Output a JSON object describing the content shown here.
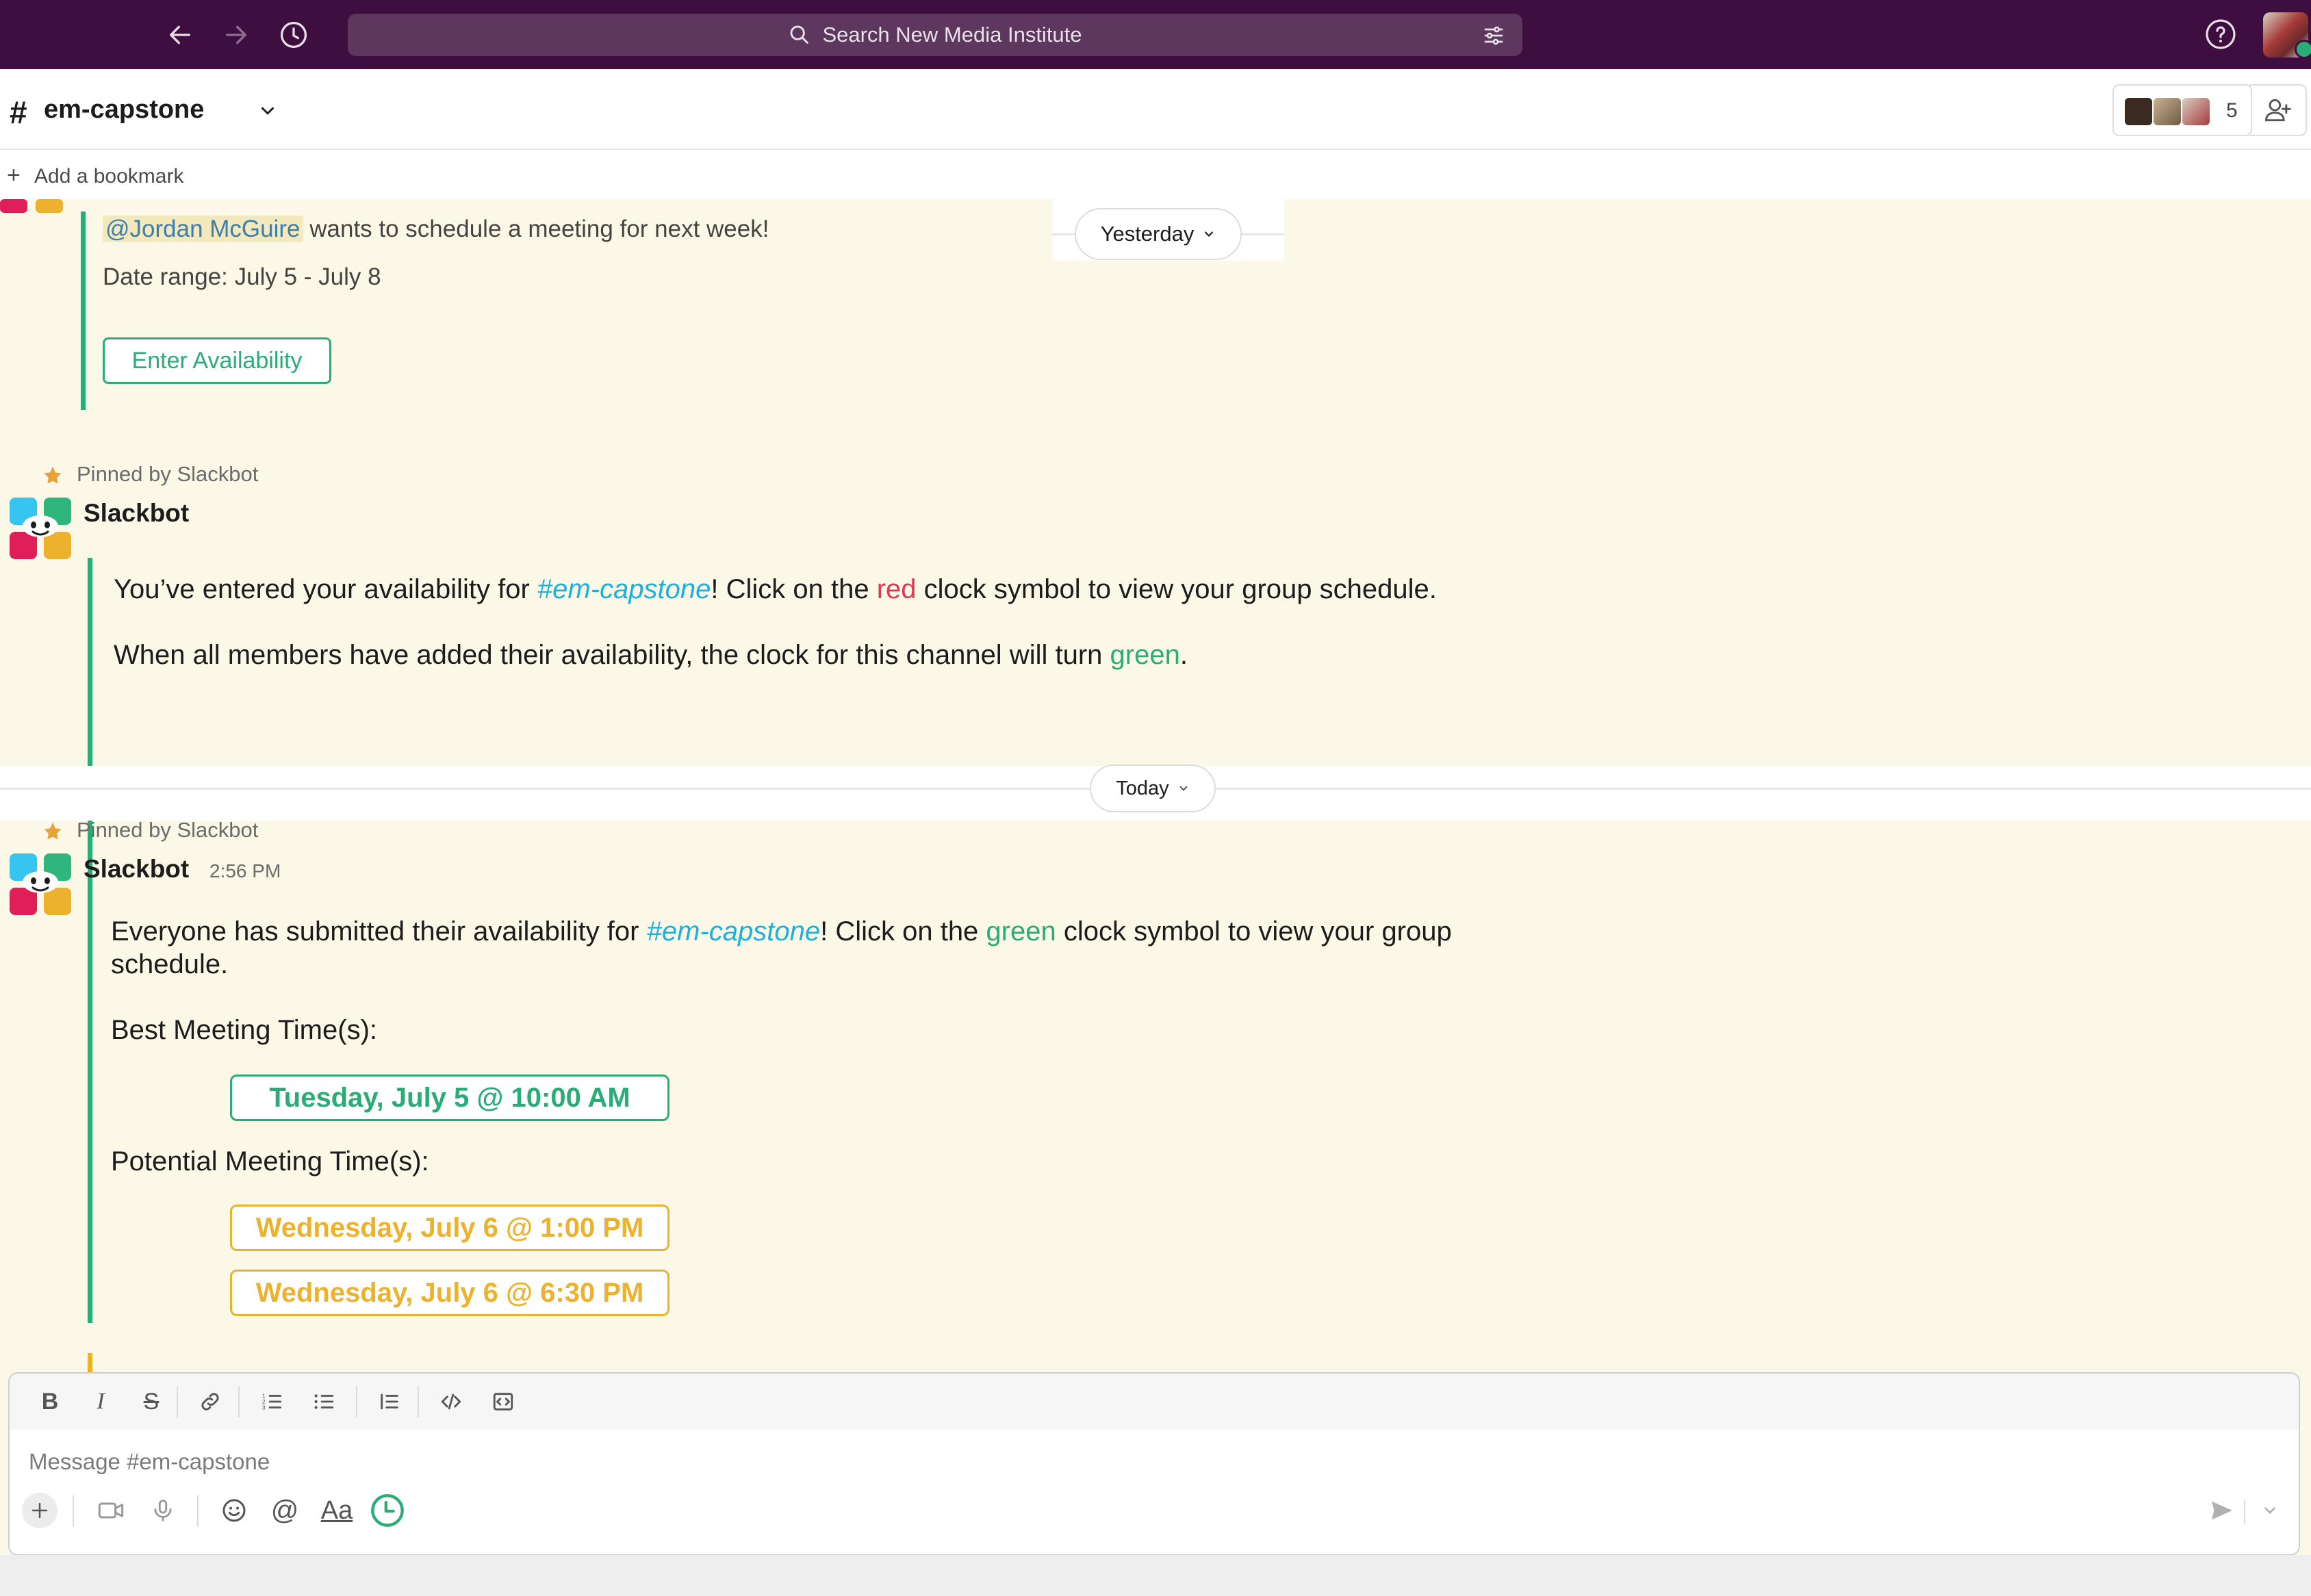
{
  "top_bar": {
    "search_placeholder": "Search New Media Institute",
    "icons": [
      "back-arrow-icon",
      "forward-arrow-icon",
      "history-icon",
      "search-icon",
      "filter-icon",
      "help-icon"
    ]
  },
  "channel": {
    "hash": "#",
    "name": "em-capstone",
    "member_count": "5"
  },
  "bookmark": {
    "plus": "+",
    "label": "Add a bookmark"
  },
  "messages": {
    "msg1": {
      "mention": "@Jordan McGuire",
      "text": " wants to schedule a meeting for next week!",
      "date_range": "Date range: July 5 - July 8",
      "button": "Enter Availability"
    },
    "divider_yesterday": "Yesterday",
    "msg2": {
      "pinned": "Pinned by Slackbot",
      "sender": "Slackbot",
      "line1_a": "You’ve entered your availability for ",
      "line1_link": "#em-capstone",
      "line1_b": "!  Click on the ",
      "line1_red": "red",
      "line1_c": " clock symbol to view your group schedule.",
      "line2_a": "When all members have added their availability, the clock for this channel will turn ",
      "line2_green": "green",
      "line2_b": "."
    },
    "divider_today": "Today",
    "msg3": {
      "pinned": "Pinned by Slackbot",
      "sender": "Slackbot",
      "time": "2:56 PM",
      "line1_a": "Everyone has submitted their availability for ",
      "line1_link": "#em-capstone",
      "line1_b": "!  Click on the ",
      "line1_green": "green",
      "line1_c": " clock symbol to view your group",
      "line1_d": "schedule.",
      "best_label": "Best Meeting Time(s):",
      "best_times": [
        "Tuesday, July 5 @ 10:00 AM"
      ],
      "potential_label": "Potential Meeting Time(s):",
      "potential_times": [
        "Wednesday, July 6 @ 1:00 PM",
        "Wednesday, July 6 @ 6:30 PM"
      ]
    }
  },
  "composer": {
    "placeholder": "Message #em-capstone",
    "format_label": "Aa"
  },
  "colors": {
    "sidebar_purple": "#3f0e40",
    "green": "#2bac76",
    "yellow": "#ecb22e",
    "red": "#e03a4f",
    "link": "#1ab0e0",
    "message_bg": "#fcf8e8"
  }
}
